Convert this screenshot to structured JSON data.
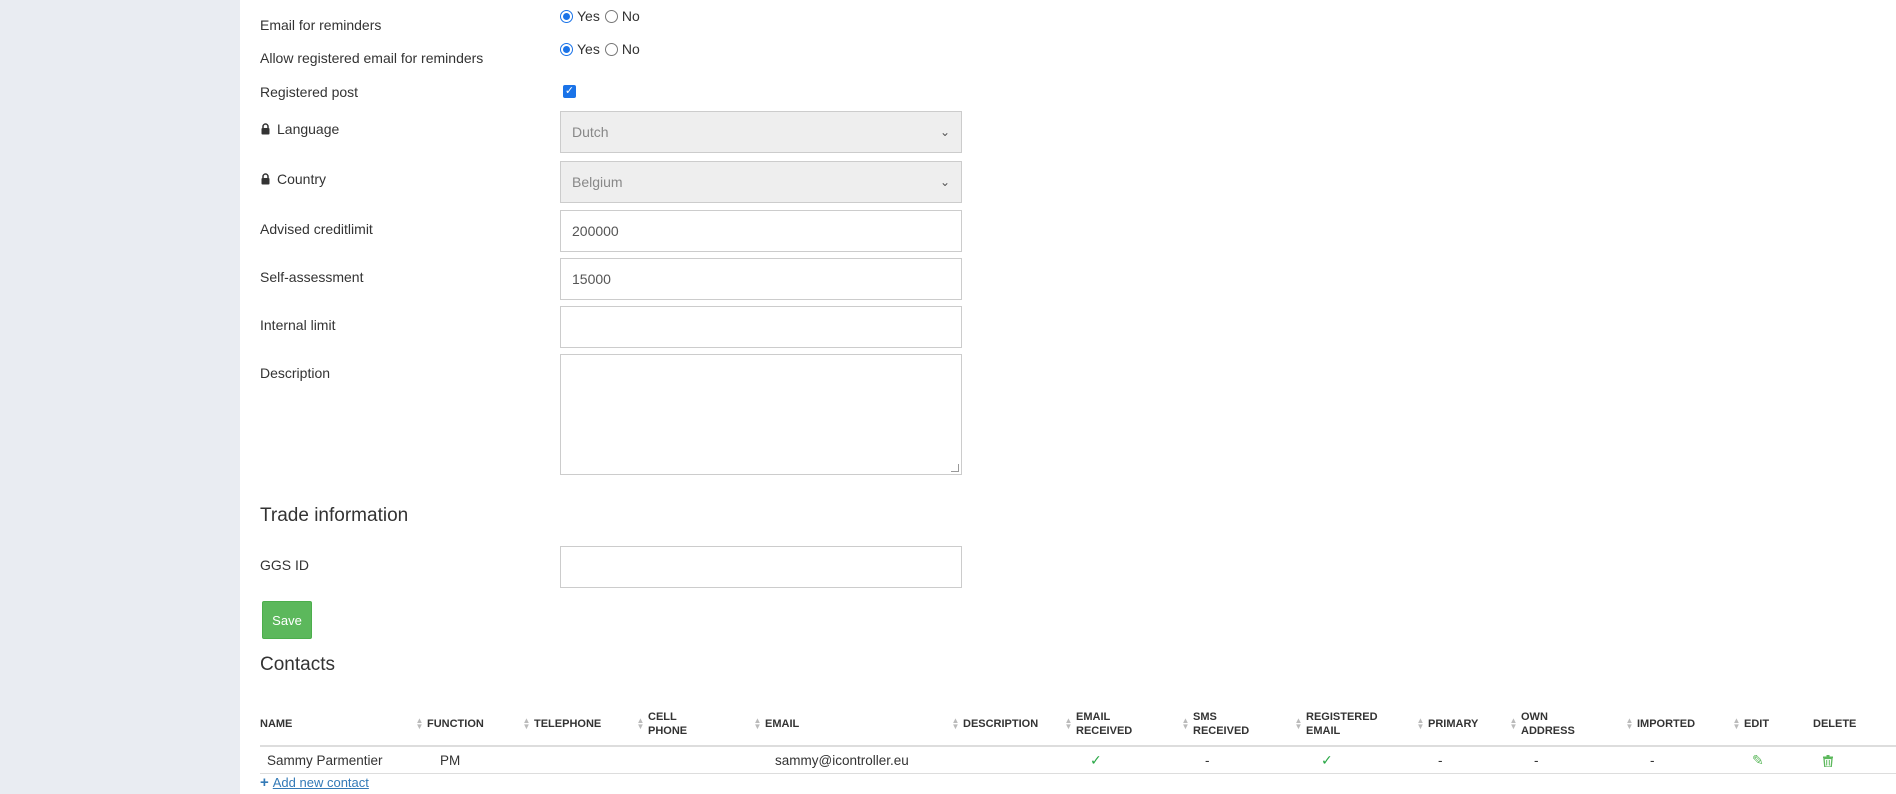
{
  "form": {
    "email_reminders": {
      "label": "Email for reminders",
      "yes": "Yes",
      "no": "No",
      "selected": "Yes"
    },
    "registered_email_reminders": {
      "label": "Allow registered email for reminders",
      "yes": "Yes",
      "no": "No",
      "selected": "Yes"
    },
    "registered_post": {
      "label": "Registered post",
      "checked": true
    },
    "language": {
      "label": "Language",
      "value": "Dutch",
      "locked": true
    },
    "country": {
      "label": "Country",
      "value": "Belgium",
      "locked": true
    },
    "advised_creditlimit": {
      "label": "Advised creditlimit",
      "value": "200000"
    },
    "self_assessment": {
      "label": "Self-assessment",
      "value": "15000"
    },
    "internal_limit": {
      "label": "Internal limit",
      "value": ""
    },
    "description": {
      "label": "Description",
      "value": ""
    }
  },
  "trade": {
    "title": "Trade information",
    "ggs_id": {
      "label": "GGS ID",
      "value": ""
    }
  },
  "save_label": "Save",
  "contacts": {
    "title": "Contacts",
    "columns": {
      "name": "NAME",
      "function": "FUNCTION",
      "telephone": "TELEPHONE",
      "cell_phone_1": "CELL",
      "cell_phone_2": "PHONE",
      "email": "EMAIL",
      "description": "DESCRIPTION",
      "email_received_1": "EMAIL",
      "email_received_2": "RECEIVED",
      "sms_received_1": "SMS",
      "sms_received_2": "RECEIVED",
      "registered_email_1": "REGISTERED",
      "registered_email_2": "EMAIL",
      "primary": "PRIMARY",
      "own_address_1": "OWN",
      "own_address_2": "ADDRESS",
      "imported": "IMPORTED",
      "edit": "EDIT",
      "delete": "DELETE"
    },
    "rows": [
      {
        "name": "Sammy Parmentier",
        "function": "PM",
        "telephone": "",
        "cell_phone": "",
        "email": "sammy@icontroller.eu",
        "description": "",
        "email_received": true,
        "sms_received": "-",
        "registered_email": true,
        "primary": "-",
        "own_address": "-",
        "imported": "-"
      }
    ],
    "add_label": "Add new contact"
  },
  "colors": {
    "accent": "#1a73e8",
    "save": "#5cb85c",
    "link": "#337ab7",
    "check": "#28a745",
    "sidebar": "#e9ecf2"
  }
}
